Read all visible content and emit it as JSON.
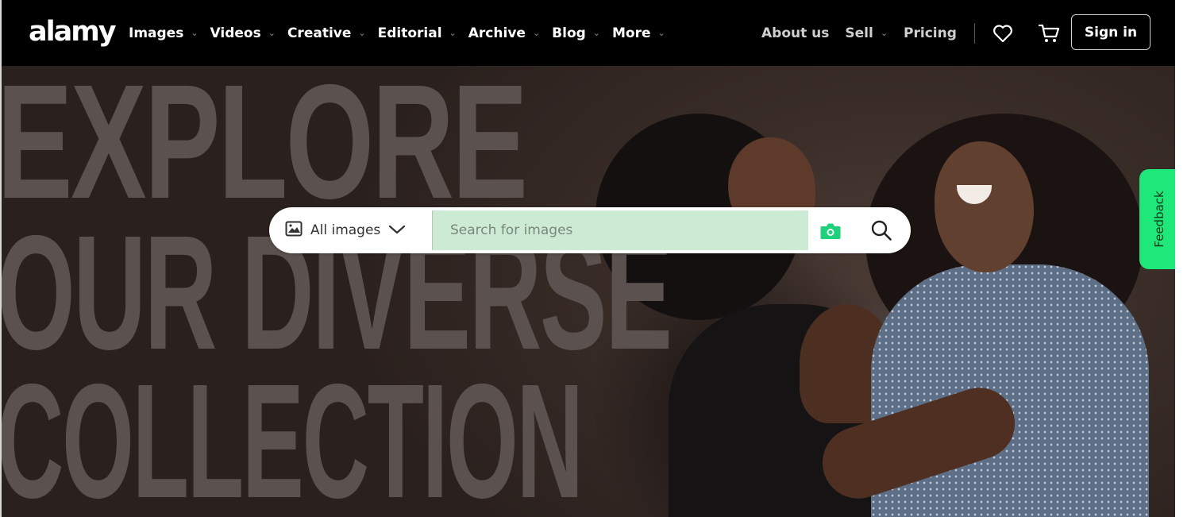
{
  "header": {
    "logo": "alamy",
    "nav": [
      {
        "label": "Images"
      },
      {
        "label": "Videos"
      },
      {
        "label": "Creative"
      },
      {
        "label": "Editorial"
      },
      {
        "label": "Archive"
      },
      {
        "label": "Blog"
      },
      {
        "label": "More"
      }
    ],
    "about_label": "About us",
    "sell_label": "Sell",
    "pricing_label": "Pricing",
    "favorites_icon": "heart-icon",
    "cart_icon": "cart-icon",
    "signin_label": "Sign in"
  },
  "hero": {
    "headline": [
      "EXPLORE",
      "OUR DIVERSE",
      "COLLECTION"
    ]
  },
  "search": {
    "scope_label": "All images",
    "scope_icon": "image-icon",
    "placeholder": "Search for images",
    "value": "",
    "camera_icon": "camera-icon",
    "search_icon": "search-icon"
  },
  "feedback": {
    "label": "Feedback"
  },
  "colors": {
    "header_bg": "#000000",
    "hero_bg": "#2a201e",
    "headline_text": "#5b514f",
    "search_field_bg": "#cdebd4",
    "accent_green": "#1ee879"
  }
}
